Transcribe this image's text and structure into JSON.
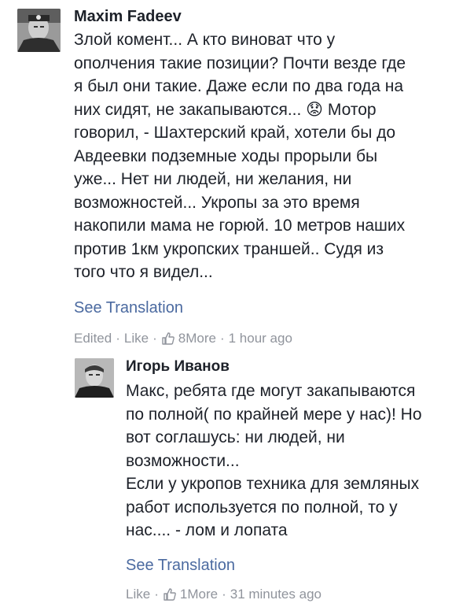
{
  "comments": [
    {
      "author": "Maxim Fadeev",
      "text": "Злой комент... А кто виноват что у\nополчения такие позиции? Почти везде где\nя был они такие. Даже если по два года на\nних сидят, не закапываются... 😟 Мотор\nговорил, - Шахтерский край, хотели бы до\nАвдеевки подземные ходы прорыли бы\nуже... Нет ни людей, ни желания, ни\nвозможностей... Укропы за это время\nнакопили мама не горюй. 10 метров наших\nпротив 1км укропских траншей.. Судя из\nтого что я видел...",
      "see_translation": "See Translation",
      "edited": "Edited",
      "like": "Like",
      "likes_count": "8",
      "more": "More",
      "time": "1 hour ago",
      "avatar_icon": "person-photo-icon"
    },
    {
      "author": "Игорь Иванов",
      "text": "Макс, ребята где могут закапываются\nпо полной( по крайней мере у нас)! Но\nвот соглашусь: ни людей, ни\nвозможности...\nЕсли у укропов техника для земляных\nработ используется по полной, то у\nнас.... - лом и лопата",
      "see_translation": "See Translation",
      "like": "Like",
      "likes_count": "1",
      "more": "More",
      "time": "31 minutes ago",
      "avatar_icon": "person-photo-icon"
    }
  ],
  "separator": "·",
  "colors": {
    "text": "#1d2129",
    "link": "#4b6aa0",
    "meta": "#90949c"
  }
}
